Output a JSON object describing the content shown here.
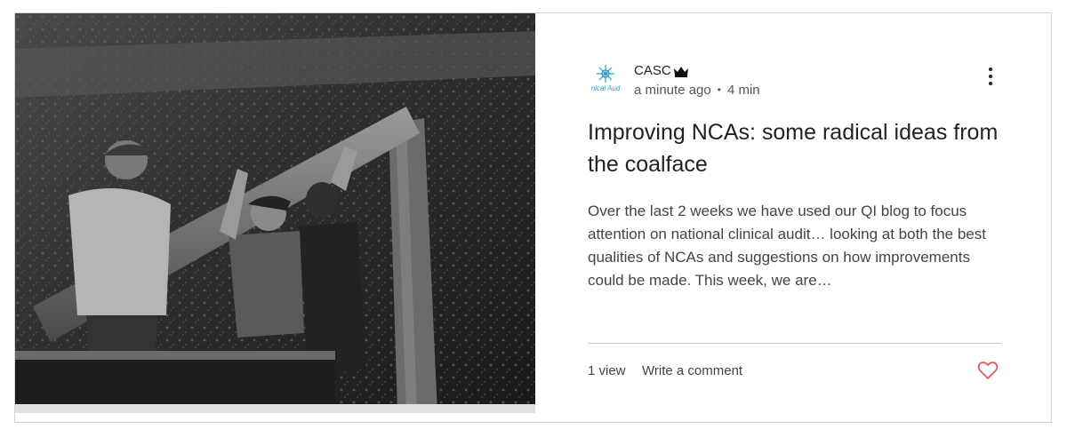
{
  "post": {
    "author": {
      "name": "CASC",
      "avatar_text": "nical Aud",
      "badge_icon": "crown-icon"
    },
    "time_ago": "a minute ago",
    "separator": "•",
    "read_time": "4 min",
    "title": "Improving NCAs: some radical ideas from the coalface",
    "excerpt": "Over the last 2 weeks we have used our QI blog to focus attention on national clinical audit… looking at both the best qualities of NCAs and suggestions on how improvements could be made. This week, we are…",
    "views": "1 view",
    "comment_label": "Write a comment",
    "more_icon": "more-vertical-icon",
    "like_icon": "heart-icon"
  },
  "colors": {
    "heart": "#e05a5a",
    "logo_accent": "#2aa0c8",
    "border": "#d4d4d4"
  }
}
